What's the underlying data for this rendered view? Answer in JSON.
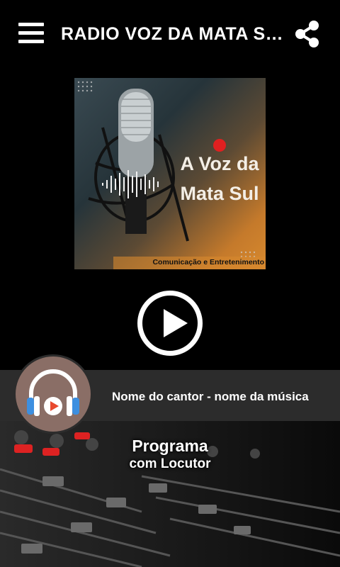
{
  "header": {
    "title": "RADIO VOZ DA MATA SUL"
  },
  "cover": {
    "title_line1": "A Voz da",
    "title_line2": "Mata Sul",
    "subtitle": "Comunicação e Entretenimento"
  },
  "now_playing": {
    "track": "Nome do cantor - nome da música"
  },
  "program": {
    "name": "Programa",
    "host": "com Locutor"
  },
  "colors": {
    "background": "#000000",
    "now_bar": "#2c2c2c",
    "avatar_bg": "#8a6e66",
    "headphone_blue": "#3d8fe0",
    "play_red": "#e8492e"
  },
  "icons": {
    "menu": "hamburger-icon",
    "share": "share-icon",
    "play": "play-icon",
    "headphones": "headphones-icon"
  }
}
